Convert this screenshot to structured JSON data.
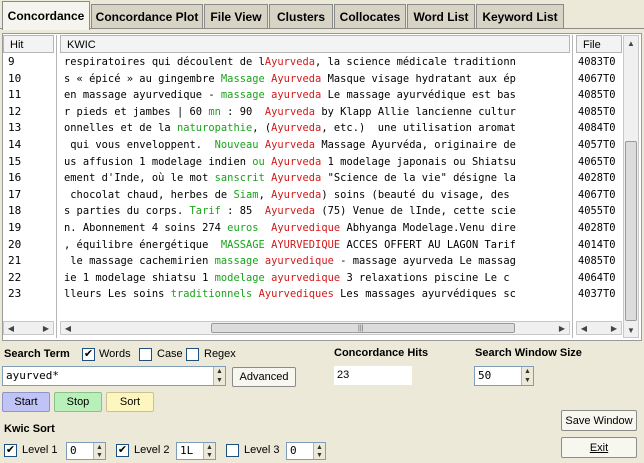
{
  "tabs": [
    {
      "label": "Concordance",
      "active": true
    },
    {
      "label": "Concordance Plot",
      "active": false
    },
    {
      "label": "File View",
      "active": false
    },
    {
      "label": "Clusters",
      "active": false
    },
    {
      "label": "Collocates",
      "active": false
    },
    {
      "label": "Word List",
      "active": false
    },
    {
      "label": "Keyword List",
      "active": false
    }
  ],
  "columns": {
    "hit": "Hit",
    "kwic": "KWIC",
    "file": "File"
  },
  "rows": [
    {
      "hit": "9",
      "file": "4083T0",
      "kwic": [
        [
          "respiratoires qui découlent de l",
          ""
        ],
        [
          "Ayurveda",
          "red"
        ],
        [
          ", la science médicale traditionn",
          ""
        ]
      ]
    },
    {
      "hit": "10",
      "file": "4067T0",
      "kwic": [
        [
          "s « épicé » au gingembre ",
          ""
        ],
        [
          "Massage",
          "green"
        ],
        [
          " ",
          ""
        ],
        [
          "Ayurveda",
          "red"
        ],
        [
          " Masque visage hydratant aux ép",
          ""
        ]
      ]
    },
    {
      "hit": "11",
      "file": "4085T0",
      "kwic": [
        [
          "en massage ayurvedique - ",
          ""
        ],
        [
          "massage",
          "green"
        ],
        [
          " ",
          ""
        ],
        [
          "ayurveda",
          "red"
        ],
        [
          " Le massage ayurvédique est bas",
          ""
        ]
      ]
    },
    {
      "hit": "12",
      "file": "4085T0",
      "kwic": [
        [
          "r pieds et jambes | 60 ",
          ""
        ],
        [
          "mn",
          "green"
        ],
        [
          " : 90  ",
          ""
        ],
        [
          "Ayurveda",
          "red"
        ],
        [
          " by Klapp Allie lancienne cultur",
          ""
        ]
      ]
    },
    {
      "hit": "13",
      "file": "4084T0",
      "kwic": [
        [
          "onnelles et de la ",
          ""
        ],
        [
          "naturopathie",
          "green"
        ],
        [
          ", (",
          ""
        ],
        [
          "Ayurveda",
          "red"
        ],
        [
          ", etc.)  une utilisation aromat",
          ""
        ]
      ]
    },
    {
      "hit": "14",
      "file": "4057T0",
      "kwic": [
        [
          " qui vous enveloppent.  ",
          ""
        ],
        [
          "Nouveau",
          "green"
        ],
        [
          " ",
          ""
        ],
        [
          "Ayurveda",
          "red"
        ],
        [
          " Massage Ayurvéda, originaire de",
          ""
        ]
      ]
    },
    {
      "hit": "15",
      "file": "4065T0",
      "kwic": [
        [
          "us affusion 1 modelage indien ",
          ""
        ],
        [
          "ou",
          "green"
        ],
        [
          " ",
          ""
        ],
        [
          "Ayurveda",
          "red"
        ],
        [
          " 1 modelage japonais ou Shiatsu",
          ""
        ]
      ]
    },
    {
      "hit": "16",
      "file": "4028T0",
      "kwic": [
        [
          "ement d'Inde, où le mot ",
          ""
        ],
        [
          "sanscrit",
          "green"
        ],
        [
          " ",
          ""
        ],
        [
          "Ayurveda",
          "red"
        ],
        [
          " \"Science de la vie\" désigne la",
          ""
        ]
      ]
    },
    {
      "hit": "17",
      "file": "4067T0",
      "kwic": [
        [
          " chocolat chaud, herbes de ",
          ""
        ],
        [
          "Siam",
          "green"
        ],
        [
          ", ",
          ""
        ],
        [
          "Ayurveda",
          "red"
        ],
        [
          ") soins (beauté du visage, des",
          ""
        ]
      ]
    },
    {
      "hit": "18",
      "file": "4055T0",
      "kwic": [
        [
          "s parties du corps. ",
          ""
        ],
        [
          "Tarif",
          "green"
        ],
        [
          " : 85  ",
          ""
        ],
        [
          "Ayurveda",
          "red"
        ],
        [
          " (75) Venue de lInde, cette scie",
          ""
        ]
      ]
    },
    {
      "hit": "19",
      "file": "4028T0",
      "kwic": [
        [
          "n. Abonnement 4 soins 274 ",
          ""
        ],
        [
          "euros",
          "green"
        ],
        [
          "  ",
          ""
        ],
        [
          "Ayurvedique",
          "red"
        ],
        [
          " Abhyanga Modelage.Venu dire",
          ""
        ]
      ]
    },
    {
      "hit": "20",
      "file": "4014T0",
      "kwic": [
        [
          ", équilibre énergétique  ",
          ""
        ],
        [
          "MASSAGE",
          "green"
        ],
        [
          " ",
          ""
        ],
        [
          "AYURVEDIQUE",
          "red"
        ],
        [
          " ACCES OFFERT AU LAGON Tarif",
          ""
        ]
      ]
    },
    {
      "hit": "21",
      "file": "4085T0",
      "kwic": [
        [
          " le massage cachemirien ",
          ""
        ],
        [
          "massage",
          "green"
        ],
        [
          " ",
          ""
        ],
        [
          "ayurvedique",
          "red"
        ],
        [
          " - massage ayurveda Le massag",
          ""
        ]
      ]
    },
    {
      "hit": "22",
      "file": "4064T0",
      "kwic": [
        [
          "ie 1 modelage shiatsu 1 ",
          ""
        ],
        [
          "modelage",
          "green"
        ],
        [
          " ",
          ""
        ],
        [
          "ayurvedique",
          "red"
        ],
        [
          " 3 relaxations piscine Le c",
          ""
        ]
      ]
    },
    {
      "hit": "23",
      "file": "4037T0",
      "kwic": [
        [
          "lleurs Les soins ",
          ""
        ],
        [
          "traditionnels",
          "green"
        ],
        [
          " ",
          ""
        ],
        [
          "Ayurvediques",
          "red"
        ],
        [
          " Les massages ayurvédiques sc",
          ""
        ]
      ]
    }
  ],
  "colors": {
    "green": "#1aa31a",
    "red": "#d11a1a",
    "start": "#bfc3f5",
    "stop": "#b9f0b9",
    "sort": "#fdf7bf",
    "background": "#ece9d8"
  },
  "search": {
    "label": "Search Term",
    "words_label": "Words",
    "words_checked": true,
    "case_label": "Case",
    "case_checked": false,
    "regex_label": "Regex",
    "regex_checked": false,
    "value": "ayurved*",
    "advanced_label": "Advanced"
  },
  "hits": {
    "label": "Concordance Hits",
    "value": "23"
  },
  "window": {
    "label": "Search Window Size",
    "value": "50"
  },
  "buttons": {
    "start": "Start",
    "stop": "Stop",
    "sort": "Sort",
    "save": "Save Window",
    "exit": "Exit"
  },
  "kwic_sort": {
    "label": "Kwic Sort",
    "levels": [
      {
        "label": "Level 1",
        "checked": true,
        "value": "0"
      },
      {
        "label": "Level 2",
        "checked": true,
        "value": "1L"
      },
      {
        "label": "Level 3",
        "checked": false,
        "value": "0"
      }
    ]
  },
  "icons": {
    "check": "check-icon",
    "arrow-up": "arrow-up-icon",
    "arrow-down": "arrow-down-icon",
    "arrow-left": "arrow-left-icon",
    "arrow-right": "arrow-right-icon",
    "grip": "grip-icon"
  }
}
